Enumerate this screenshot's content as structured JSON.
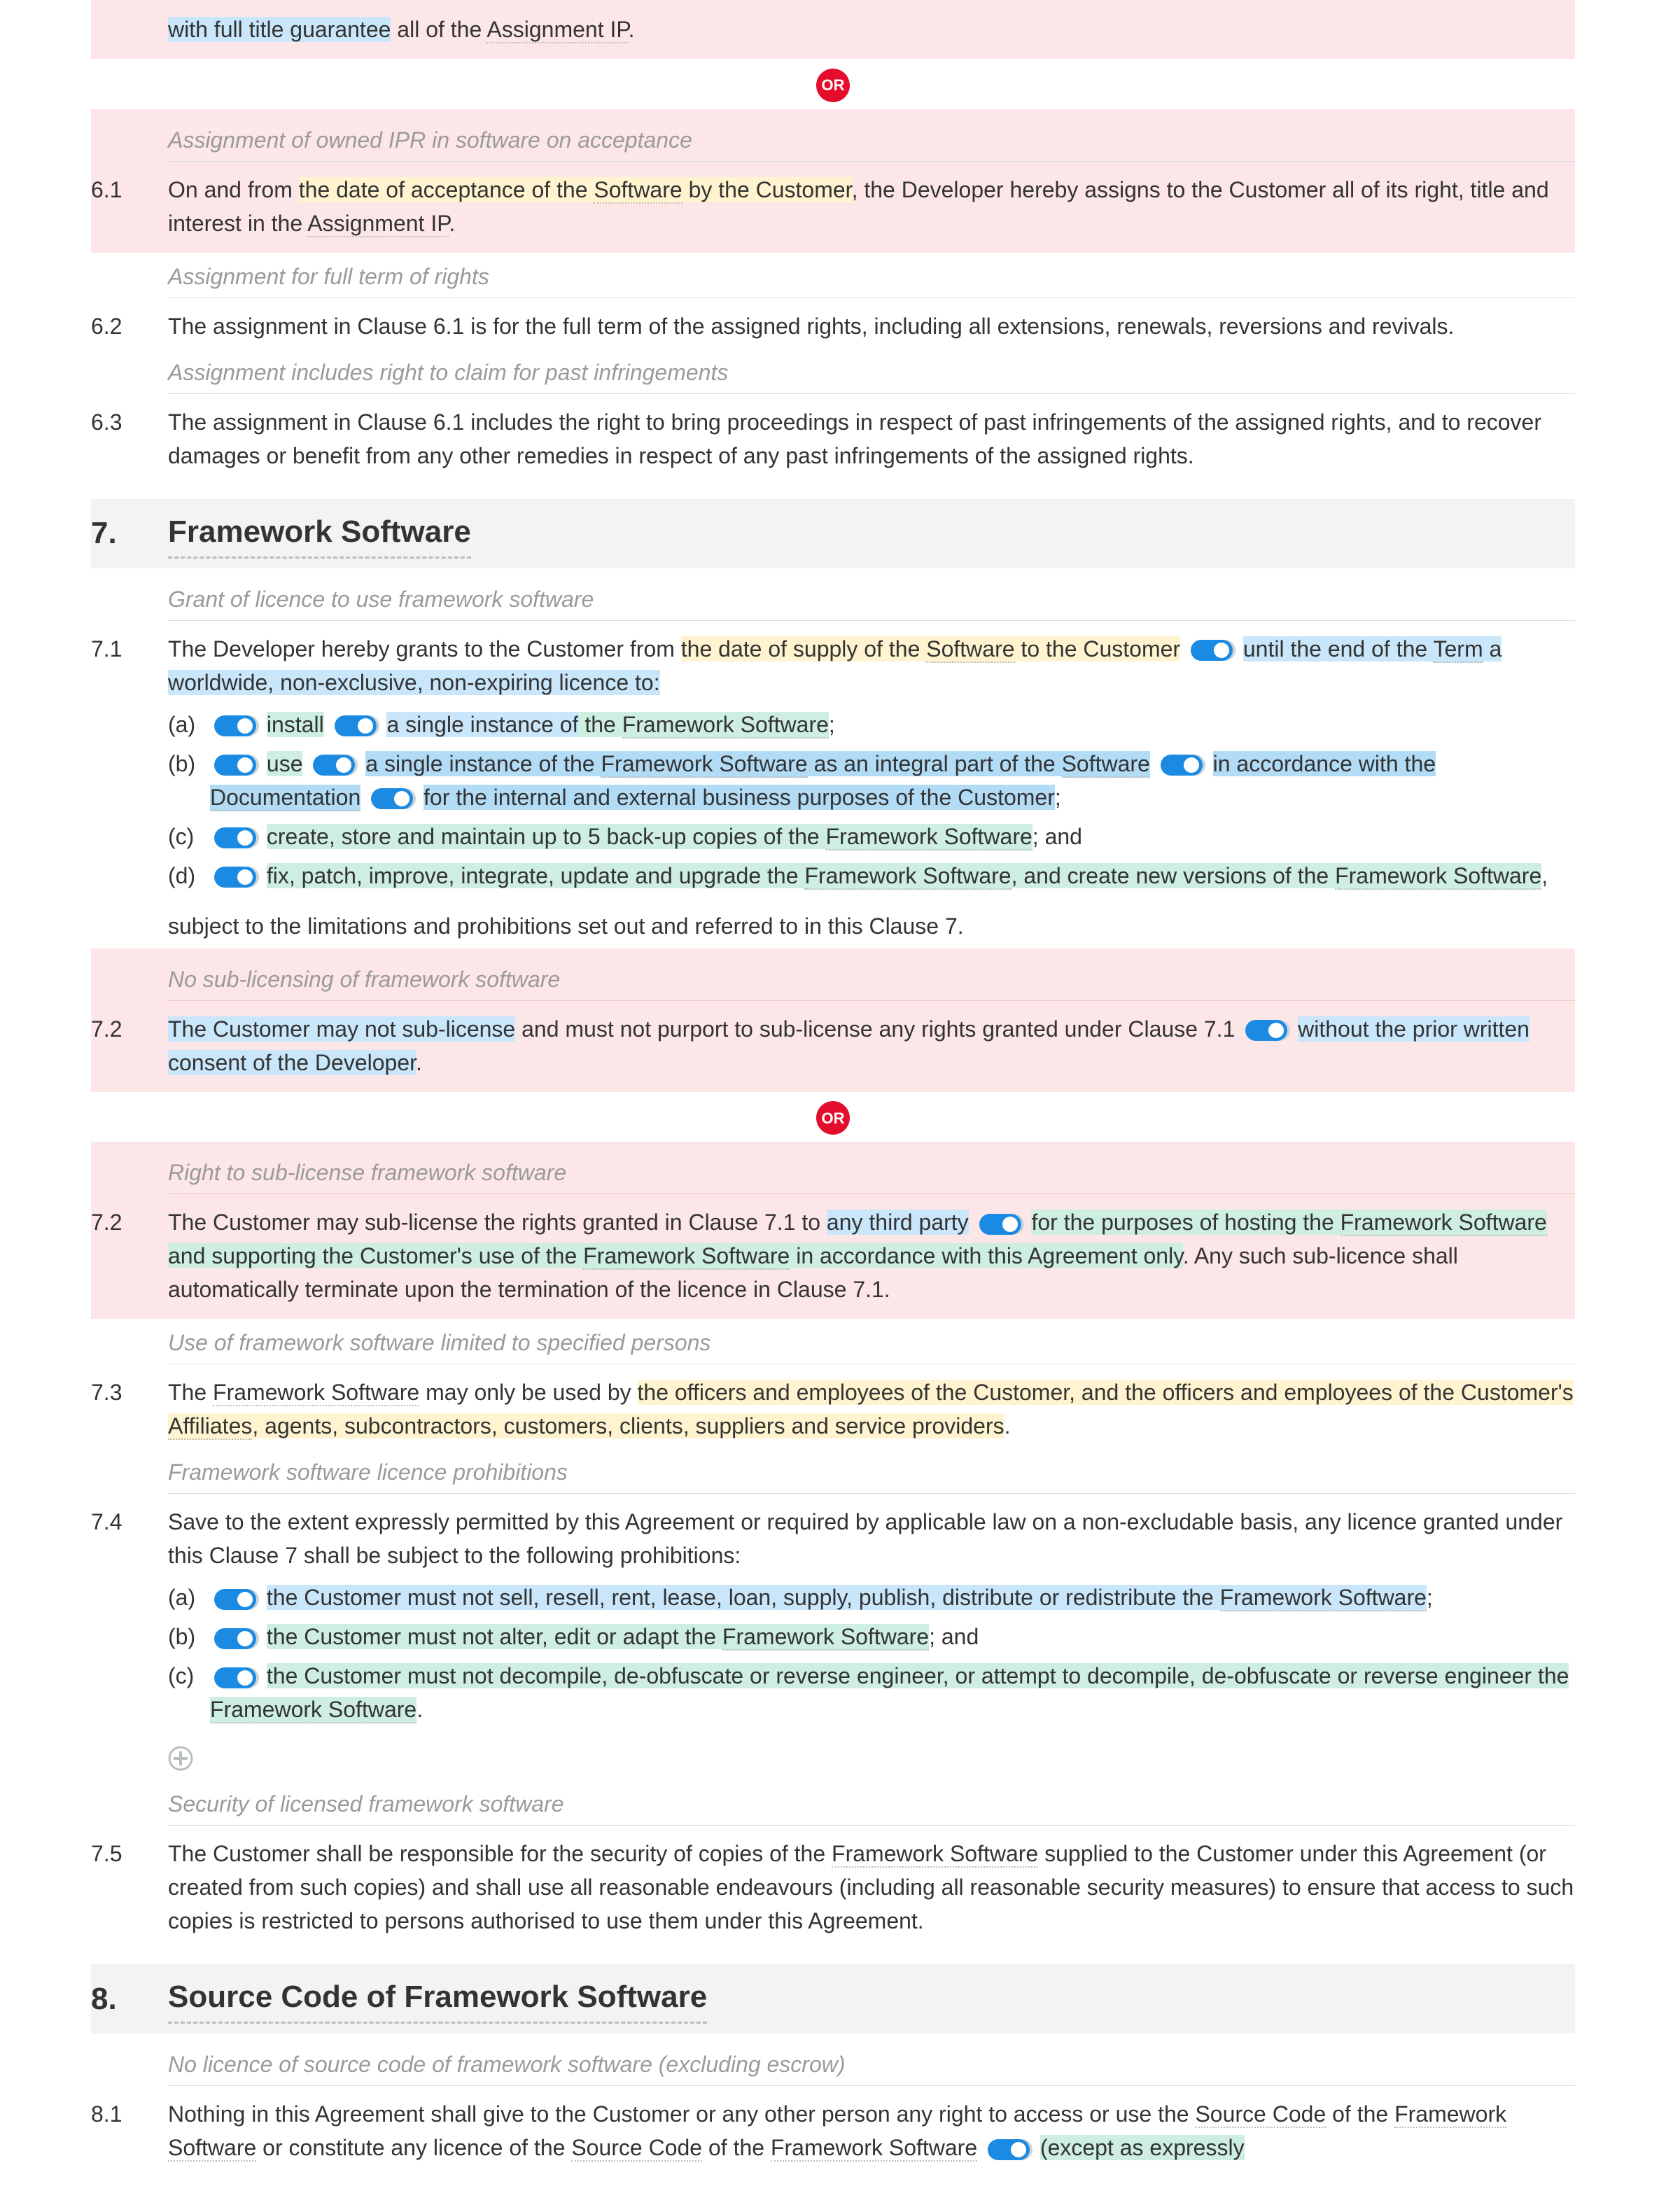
{
  "top_fragment": {
    "line_pre": "with full title guarantee",
    "line_mid": " all of the ",
    "assignment_ip": "Assignment IP",
    "line_end": "."
  },
  "or_label": "OR",
  "s6": {
    "sub_a": "Assignment of owned IPR in software on acceptance",
    "c61_num": "6.1",
    "c61_a": "On and from ",
    "c61_b": "the date of acceptance of the ",
    "c61_sw": "Software",
    "c61_c": " by the Customer",
    "c61_d": ", the Developer hereby assigns to the Customer all of its right, title and interest in the ",
    "c61_aip": "Assignment IP",
    "c61_e": ".",
    "sub_b": "Assignment for full term of rights",
    "c62_num": "6.2",
    "c62": "The assignment in Clause 6.1 is for the full term of the assigned rights, including all extensions, renewals, reversions and revivals.",
    "sub_c": "Assignment includes right to claim for past infringements",
    "c63_num": "6.3",
    "c63": "The assignment in Clause 6.1 includes the right to bring proceedings in respect of past infringements of the assigned rights, and to recover damages or benefit from any other remedies in respect of any past infringements of the assigned rights."
  },
  "s7": {
    "num": "7.",
    "title": "Framework Software",
    "sub_grant": "Grant of licence to use framework software",
    "c71_num": "7.1",
    "c71_a": "The Developer hereby grants to the Customer from ",
    "c71_b": "the date of supply of the ",
    "c71_sw": "Software",
    "c71_c": " to the Customer",
    "c71_d": "until the end of the ",
    "c71_term": "Term",
    "c71_e": " a worldwide, non-exclusive, non-expiring licence to:",
    "a_label": "(a)",
    "a_1": "install",
    "a_2": "a single instance of",
    "a_3": " the ",
    "a_fw": "Framework Software",
    "a_4": ";",
    "b_label": "(b)",
    "b_1": "use",
    "b_2": "a single instance of",
    "b_3": " the ",
    "b_fw": "Framework Software",
    "b_4": " as an integral part of the ",
    "b_sw": "Software",
    "b_5": "in accordance with the ",
    "b_doc": "Documentation",
    "b_6": "for the internal and external business purposes of the Customer",
    "b_7": ";",
    "c_label": "(c)",
    "c_1": "create, store and maintain up to 5 back-up copies of the ",
    "c_fw": "Framework Software",
    "c_2": "; and",
    "d_label": "(d)",
    "d_1": "fix, patch, improve, integrate, update and upgrade the ",
    "d_fw1": "Framework Software",
    "d_2": ", and create new versions of the ",
    "d_fw2": "Framework Software",
    "d_3": ",",
    "c71_tail": "subject to the limitations and prohibitions set out and referred to in this Clause 7.",
    "sub_nosub": "No sub-licensing of framework software",
    "c72a_num": "7.2",
    "c72a_1": "The Customer may not sub-license",
    "c72a_2": " and must not purport to sub-license any rights granted under Clause 7.1",
    "c72a_3": " without the prior written consent of the Developer",
    "c72a_4": ".",
    "sub_right": "Right to sub-license framework software",
    "c72b_num": "7.2",
    "c72b_1": "The Customer may sub-license the rights granted in Clause 7.1 to ",
    "c72b_2": "any third party",
    "c72b_3": "for the purposes of hosting the ",
    "c72b_fw1": "Framework Software",
    "c72b_4": " and supporting the Customer's use of the ",
    "c72b_fw2": "Framework Software",
    "c72b_5": " in accordance with this Agreement only",
    "c72b_6": ". Any such sub-licence shall automatically terminate upon the termination of the licence in Clause 7.1.",
    "sub_use": "Use of framework software limited to specified persons",
    "c73_num": "7.3",
    "c73_1": "The ",
    "c73_fw": "Framework Software",
    "c73_2": " may only be used by ",
    "c73_3": "the officers and employees of the Customer, and the officers and employees of the Customer's ",
    "c73_aff": "Affiliates",
    "c73_4": ", agents, subcontractors, customers, clients, suppliers and service providers",
    "c73_5": ".",
    "sub_proh": "Framework software licence prohibitions",
    "c74_num": "7.4",
    "c74_intro": "Save to the extent expressly permitted by this Agreement or required by applicable law on a non-excludable basis, any licence granted under this Clause 7 shall be subject to the following prohibitions:",
    "p_a_label": "(a)",
    "p_a_1": "the Customer must not sell, resell, rent, lease, loan, supply, publish, distribute or redistribute the ",
    "p_a_fw": "Framework Software",
    "p_a_2": ";",
    "p_b_label": "(b)",
    "p_b_1": "the Customer must not alter, edit or adapt the ",
    "p_b_fw": "Framework Software",
    "p_b_2": "; and",
    "p_c_label": "(c)",
    "p_c_1": "the Customer must not decompile, de-obfuscate or reverse engineer, or attempt to decompile, de-obfuscate or reverse engineer the ",
    "p_c_fw": "Framework Software",
    "p_c_2": ".",
    "sub_sec": "Security of licensed framework software",
    "c75_num": "7.5",
    "c75_1": "The Customer shall be responsible for the security of copies of the ",
    "c75_fw": "Framework Software",
    "c75_2": " supplied to the Customer under this Agreement (or created from such copies) and shall use all reasonable endeavours (including all reasonable security measures) to ensure that access to such copies is restricted to persons authorised to use them under this Agreement."
  },
  "s8": {
    "num": "8.",
    "title": "Source Code of Framework Software",
    "sub_no": "No licence of source code of framework software (excluding escrow)",
    "c81_num": "8.1",
    "c81_1": "Nothing in this Agreement shall give to the Customer or any other person any right to access or use the ",
    "c81_sc": "Source Code",
    "c81_2": " of the ",
    "c81_fw1": "Framework Software",
    "c81_3": " or constitute any licence of the ",
    "c81_sc2": "Source Code",
    "c81_4": " of the ",
    "c81_fw2": "Framework Software",
    "c81_5": "(except as expressly"
  }
}
